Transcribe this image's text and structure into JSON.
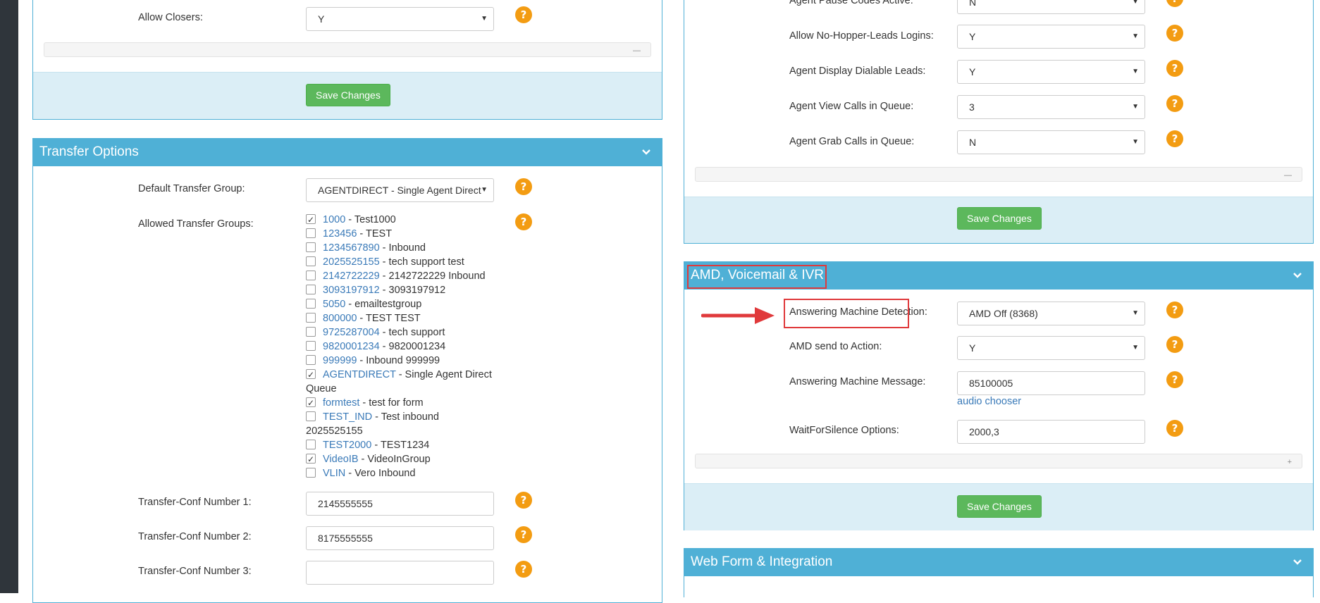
{
  "left_panel_top": {
    "allow_closers": {
      "label": "Allow Closers:",
      "value": "Y"
    },
    "save_label": "Save Changes"
  },
  "transfer_options": {
    "title": "Transfer Options",
    "default_transfer_group": {
      "label": "Default Transfer Group:",
      "value": "AGENTDIRECT - Single Agent Direct"
    },
    "allowed_transfer_groups": {
      "label": "Allowed Transfer Groups:",
      "items": [
        {
          "id": "1000",
          "desc": " - Test1000",
          "checked": true
        },
        {
          "id": "123456",
          "desc": " - TEST",
          "checked": false
        },
        {
          "id": "1234567890",
          "desc": " - Inbound",
          "checked": false
        },
        {
          "id": "2025525155",
          "desc": " - tech support test",
          "checked": false
        },
        {
          "id": "2142722229",
          "desc": " - 2142722229 Inbound",
          "checked": false
        },
        {
          "id": "3093197912",
          "desc": " - 3093197912",
          "checked": false
        },
        {
          "id": "5050",
          "desc": " - emailtestgroup",
          "checked": false
        },
        {
          "id": "800000",
          "desc": " - TEST TEST",
          "checked": false
        },
        {
          "id": "9725287004",
          "desc": " - tech support",
          "checked": false
        },
        {
          "id": "9820001234",
          "desc": " - 9820001234",
          "checked": false
        },
        {
          "id": "999999",
          "desc": " - Inbound 999999",
          "checked": false
        },
        {
          "id": "AGENTDIRECT",
          "desc": " - Single Agent Direct",
          "wrap": "Queue",
          "checked": true
        },
        {
          "id": "formtest",
          "desc": " - test for form",
          "checked": true
        },
        {
          "id": "TEST_IND",
          "desc": " - Test inbound",
          "wrap": "2025525155",
          "checked": false
        },
        {
          "id": "TEST2000",
          "desc": " - TEST1234",
          "checked": false
        },
        {
          "id": "VideoIB",
          "desc": " - VideoInGroup",
          "checked": true
        },
        {
          "id": "VLIN",
          "desc": " - Vero Inbound",
          "checked": false
        }
      ]
    },
    "conf_number_1": {
      "label": "Transfer-Conf Number 1:",
      "value": "2145555555"
    },
    "conf_number_2": {
      "label": "Transfer-Conf Number 2:",
      "value": "8175555555"
    },
    "conf_number_3": {
      "label": "Transfer-Conf Number 3:",
      "value": ""
    }
  },
  "right_panel_top": {
    "pause_codes": {
      "label": "Agent Pause Codes Active:",
      "value": "N"
    },
    "no_hopper": {
      "label": "Allow No-Hopper-Leads Logins:",
      "value": "Y"
    },
    "display_dialable": {
      "label": "Agent Display Dialable Leads:",
      "value": "Y"
    },
    "view_calls": {
      "label": "Agent View Calls in Queue:",
      "value": "3"
    },
    "grab_calls": {
      "label": "Agent Grab Calls in Queue:",
      "value": "N"
    },
    "save_label": "Save Changes"
  },
  "amd_section": {
    "title": "AMD, Voicemail & IVR",
    "amd": {
      "label": "Answering Machine Detection:",
      "value": "AMD Off (8368)"
    },
    "amd_action": {
      "label": "AMD send to Action:",
      "value": "Y"
    },
    "am_message": {
      "label": "Answering Machine Message:",
      "value": "85100005",
      "link": "audio chooser"
    },
    "wait_silence": {
      "label": "WaitForSilence Options:",
      "value": "2000,3"
    },
    "save_label": "Save Changes"
  },
  "web_form": {
    "title": "Web Form & Integration"
  },
  "help_icon_glyph": "?",
  "colors": {
    "header": "#4fb0d6",
    "save": "#5cb85c",
    "help": "#f39c12",
    "highlight": "#e0393b"
  }
}
